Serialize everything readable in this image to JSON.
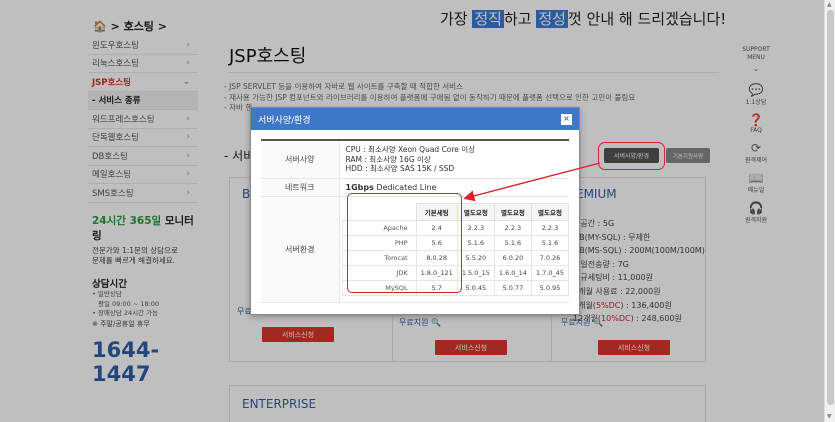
{
  "tagline": {
    "before": "가장 ",
    "hl1": "정직",
    "mid": "하고 ",
    "hl2": "정성",
    "after": "껏 안내 해 드리겠습니다!"
  },
  "breadcrumb": "🏠 > 호스팅 >",
  "sidebar": {
    "items": [
      {
        "label": "윈도우호스팅",
        "chevron": "›"
      },
      {
        "label": "리눅스호스팅",
        "chevron": "›"
      },
      {
        "label": "JSP호스팅",
        "chevron": "⌄"
      },
      {
        "label": "- 서비스 종류",
        "chevron": ""
      },
      {
        "label": "워드프레스호스팅",
        "chevron": "›"
      },
      {
        "label": "단독웹호스팅",
        "chevron": "›"
      },
      {
        "label": "DB호스팅",
        "chevron": "›"
      },
      {
        "label": "메일호스팅",
        "chevron": "›"
      },
      {
        "label": "SMS호스팅",
        "chevron": "›"
      }
    ],
    "promo_title_green": "24시간 365일",
    "promo_title_rest": " 모니터링",
    "promo_sub1": "전문가와 1:1문의 상담으로",
    "promo_sub2": "문제를 빠르게 해결하세요.",
    "hours_title": "상담시간",
    "hours_line1": "• 일반상담",
    "hours_line2": "평일 09:00 ~ 18:00",
    "hours_line3": "• 장애상담 24시간 가능",
    "hours_line4": "※ 주말/공휴일 휴무",
    "phone": "1644-1447"
  },
  "main": {
    "title": "JSP호스팅",
    "desc1": "- JSP SERVLET 등을 이용하여 자바로 웹 사이트를 구축할 때 적합한 서비스",
    "desc2": "- 재사용 가능한 JSP 컴포넌트와 라이브러리를 이용하여 플랫폼에 구애됨 없이 동작하기 때문에 플랫폼 선택으로 인한 고민이 풀림요",
    "desc3": "- 자바 핸",
    "section": "- 서비",
    "spec_button": "서버사양/환경",
    "spec_button2": "기본지원사양",
    "card_basic": "BA",
    "card_premium": "EMIUM",
    "card_enterprise": "ENTERPRISE",
    "premium_list": [
      {
        "text": "컵공간 : 5G"
      },
      {
        "text": "DB(MY-SQL) : 무제한"
      },
      {
        "text": "DB(MS-SQL) : 200M(100M/100M)"
      },
      {
        "text": "일일전송량 : 7G"
      },
      {
        "text": "신규세팅비 : 11,000원"
      },
      {
        "text": "1개월 사용료 : 22,000원"
      },
      {
        "text": "6개월(",
        "red": "5%DC",
        "tail": ") : 136,400원"
      },
      {
        "text": "12개월(",
        "red": "10%DC",
        "tail": ") : 248,600원"
      }
    ],
    "free_basic": "무료지원",
    "free_mid": "무료지원 🔍",
    "free_premium": "무료지원 🔍",
    "apply": "서비스신청"
  },
  "right_bar": [
    {
      "label": "SUPPORT MENU",
      "icon": "⌄"
    },
    {
      "label": "1:1상담",
      "icon": "💬"
    },
    {
      "label": "FAQ",
      "icon": "❓"
    },
    {
      "label": "원격제어",
      "icon": "⟳"
    },
    {
      "label": "메뉴얼",
      "icon": "📖"
    },
    {
      "label": "원격지원",
      "icon": "🎧"
    }
  ],
  "modal": {
    "title": "서버사양/환경",
    "close": "×",
    "row_server": "서버사양",
    "cpu": "CPU : 최소사양 Xeon Quad Core 이상",
    "ram": "RAM : 최소사양 16G 이상",
    "hdd": "HDD : 최소사양 SAS 15K / SSD",
    "row_network": "네트워크",
    "network_bold": "1Gbps",
    "network_rest": " Dedicated Line",
    "row_env": "서버환경",
    "headers": [
      "",
      "기본세팅",
      "별도요청",
      "별도요청",
      "별도요청"
    ],
    "rows": [
      [
        "Apache",
        "2.4",
        "2.2.3",
        "2.2.3",
        "2.2.3"
      ],
      [
        "PHP",
        "5.6",
        "5.1.6",
        "5.1.6",
        "5.1.6"
      ],
      [
        "Tomcat",
        "8.0.28",
        "5.5.20",
        "6.0.20",
        "7.0.26"
      ],
      [
        "JDK",
        "1.8.0_121",
        "1.5.0_15",
        "1.6.0_14",
        "1.7.0_45"
      ],
      [
        "MySQL",
        "5.7",
        "5.0.45",
        "5.0.77",
        "5.0.95"
      ]
    ]
  },
  "colors": {
    "accent": "#3d78c8",
    "apply": "#d9362e",
    "annotation": "#d9232d",
    "brand_blue": "#2f5fa7"
  }
}
